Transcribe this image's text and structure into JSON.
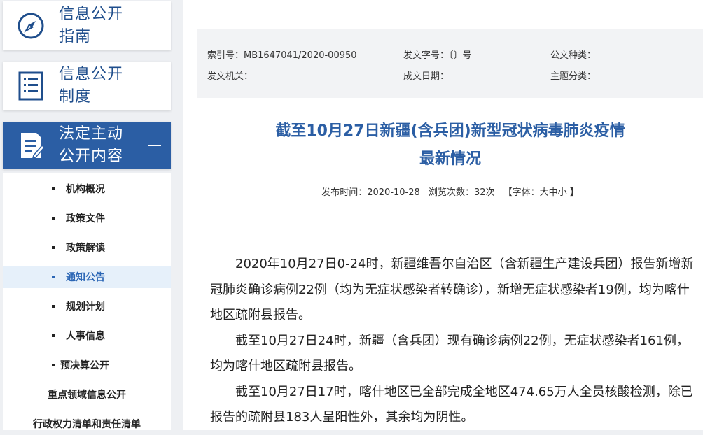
{
  "sidebar": {
    "cards": [
      {
        "line1": "信息公开",
        "line2": "指南",
        "icon": "compass-icon"
      },
      {
        "line1": "信息公开",
        "line2": "制度",
        "icon": "list-document-icon"
      },
      {
        "line1": "法定主动",
        "line2": "公开内容",
        "icon": "edit-document-icon"
      }
    ],
    "items": [
      {
        "label": "机构概况"
      },
      {
        "label": "政策文件"
      },
      {
        "label": "政策解读"
      },
      {
        "label": "通知公告",
        "active": true
      },
      {
        "label": "规划计划"
      },
      {
        "label": "人事信息"
      },
      {
        "label": "预决算公开"
      }
    ],
    "extra": [
      {
        "label": "重点领域信息公开"
      },
      {
        "label": "行政权力清单和责任清单"
      }
    ]
  },
  "meta": {
    "index_no": "索引号：MB1647041/2020-00950",
    "doc_no": "发文字号：〔〕号",
    "doc_type": "公文种类：",
    "issuer": "发文机关：",
    "date_written": "成文日期：",
    "topic": "主题分类："
  },
  "article": {
    "title_line1": "截至10月27日新疆(含兵团)新型冠状病毒肺炎疫情",
    "title_line2": "最新情况",
    "published": "发布时间：2020-10-28",
    "views": "浏览次数：32次",
    "font_size": "【字体：大中小 】",
    "paragraphs": [
      "2020年10月27日0-24时，新疆维吾尔自治区（含新疆生产建设兵团）报告新增新冠肺炎确诊病例22例（均为无症状感染者转确诊），新增无症状感染者19例，均为喀什地区疏附县报告。",
      "截至10月27日24时，新疆（含兵团）现有确诊病例22例，无症状感染者161例，均为喀什地区疏附县报告。",
      "截至10月27日17时，喀什地区已全部完成全地区474.65万人全员核酸检测，除已报告的疏附县183人呈阳性外，其余均为阴性。"
    ]
  },
  "colors": {
    "accent": "#2b5ea4",
    "active_bg": "#e6f0fa",
    "active_text": "#2b66b5"
  }
}
